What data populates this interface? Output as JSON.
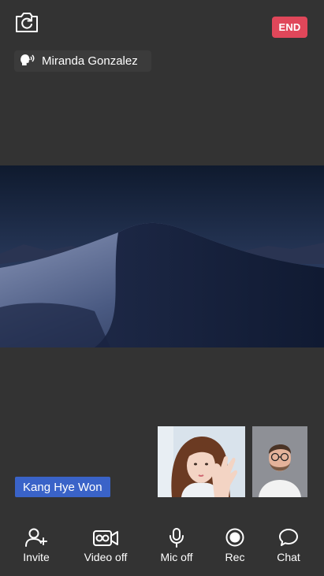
{
  "colors": {
    "background": "#333333",
    "end_button": "#e0475a",
    "name_tag": "#3a63c8"
  },
  "header": {
    "flip_camera_icon": "rotate-camera-icon",
    "end_label": "END"
  },
  "active_speaker": {
    "icon": "speaking-head-icon",
    "name": "Miranda Gonzalez"
  },
  "main_video": {
    "description_icon": "desert-dunes-video"
  },
  "participants": [
    {
      "icon": "participant-video-1"
    },
    {
      "icon": "participant-video-2"
    }
  ],
  "self_name_tag": "Kang Hye Won",
  "toolbar": [
    {
      "id": "invite",
      "label": "Invite",
      "icon": "add-user-icon"
    },
    {
      "id": "video",
      "label": "Video off",
      "icon": "video-off-icon"
    },
    {
      "id": "mic",
      "label": "Mic off",
      "icon": "microphone-icon"
    },
    {
      "id": "rec",
      "label": "Rec",
      "icon": "record-icon"
    },
    {
      "id": "chat",
      "label": "Chat",
      "icon": "chat-bubble-icon"
    }
  ]
}
